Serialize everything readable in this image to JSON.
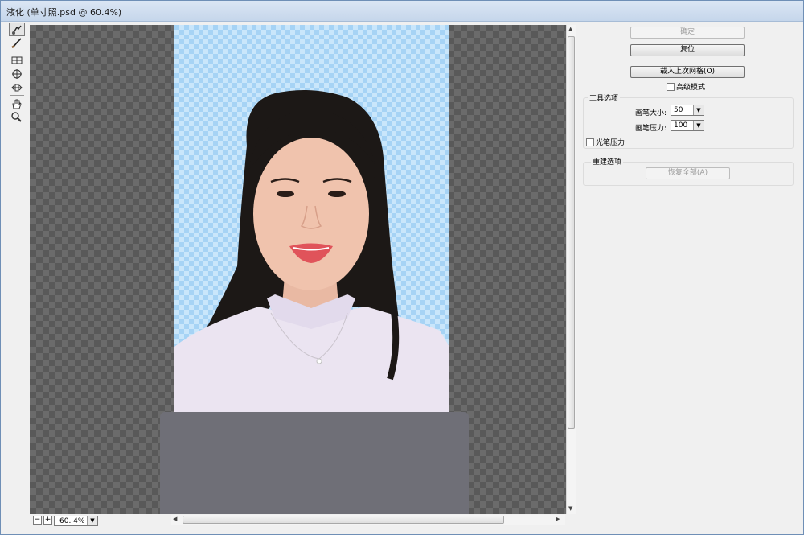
{
  "window": {
    "title": "液化 (单寸照.psd @ 60.4%)"
  },
  "zoom": {
    "value": "60. 4%",
    "minus": "−",
    "plus": "+"
  },
  "buttons": {
    "ok": "确定",
    "reset": "复位",
    "load_mesh": "载入上次网格(O)",
    "restore_all": "恢复全部(A)"
  },
  "advanced_mode": {
    "label": "高级模式",
    "checked": false
  },
  "tool_options": {
    "title": "工具选项",
    "brush_size_label": "画笔大小:",
    "brush_size": "50",
    "brush_pressure_label": "画笔压力:",
    "brush_pressure": "100",
    "stylus_pressure_label": "光笔压力",
    "stylus_pressure_checked": false
  },
  "reconstruct_options": {
    "title": "重建选项"
  },
  "tools": [
    {
      "name": "forward-warp-tool",
      "icon": "finger-brush"
    },
    {
      "name": "reconstruct-tool",
      "icon": "brush"
    },
    {
      "name": "pucker-tool",
      "icon": "pucker"
    },
    {
      "name": "bloat-tool",
      "icon": "bloat"
    },
    {
      "name": "push-left-tool",
      "icon": "push-left"
    },
    {
      "name": "hand-tool",
      "icon": "hand"
    },
    {
      "name": "zoom-tool",
      "icon": "magnifier"
    }
  ],
  "colors": {
    "title_bar": "#c5d6eb",
    "canvas_bg": "#a6d3f5",
    "mask": "#6f6f77"
  }
}
